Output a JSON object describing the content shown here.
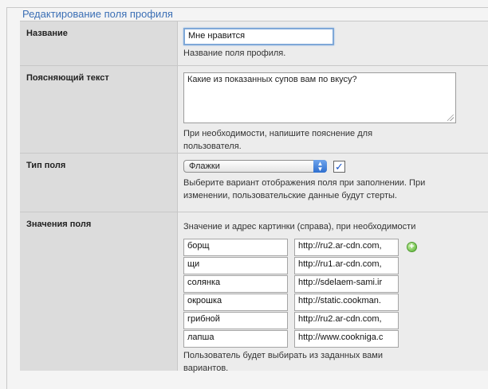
{
  "legend": "Редактирование поля профиля",
  "rows": {
    "name": {
      "label": "Название",
      "value": "Мне нравится",
      "hint": "Название поля профиля."
    },
    "description": {
      "label": "Поясняющий текст",
      "value": "Какие из показанных супов вам по вкусу?",
      "hint1": "При необходимости, напишите пояснение для",
      "hint2": "пользователя."
    },
    "type": {
      "label": "Тип поля",
      "selected": "Флажки",
      "checkbox_checked": true,
      "hint1": "Выберите вариант отображения поля при заполнении. При",
      "hint2": "изменении, пользовательские данные будут стерты."
    },
    "values": {
      "label": "Значения поля",
      "caption": "Значение и адрес картинки (справа), при необходимости",
      "items": [
        {
          "value": "борщ",
          "url": "http://ru2.ar-cdn.com,"
        },
        {
          "value": "щи",
          "url": "http://ru1.ar-cdn.com,"
        },
        {
          "value": "солянка",
          "url": "http://sdelaem-sami.ir"
        },
        {
          "value": "окрошка",
          "url": "http://static.cookman."
        },
        {
          "value": "грибной",
          "url": "http://ru2.ar-cdn.com,"
        },
        {
          "value": "лапша",
          "url": "http://www.cookniga.c"
        }
      ],
      "hint1": "Пользователь будет выбирать из заданных вами",
      "hint2": "вариантов."
    }
  },
  "colors": {
    "legend": "#3b6fb5",
    "label_bg": "#dcdcdc",
    "value_bg": "#ececec",
    "focus": "#7fa8d8"
  }
}
